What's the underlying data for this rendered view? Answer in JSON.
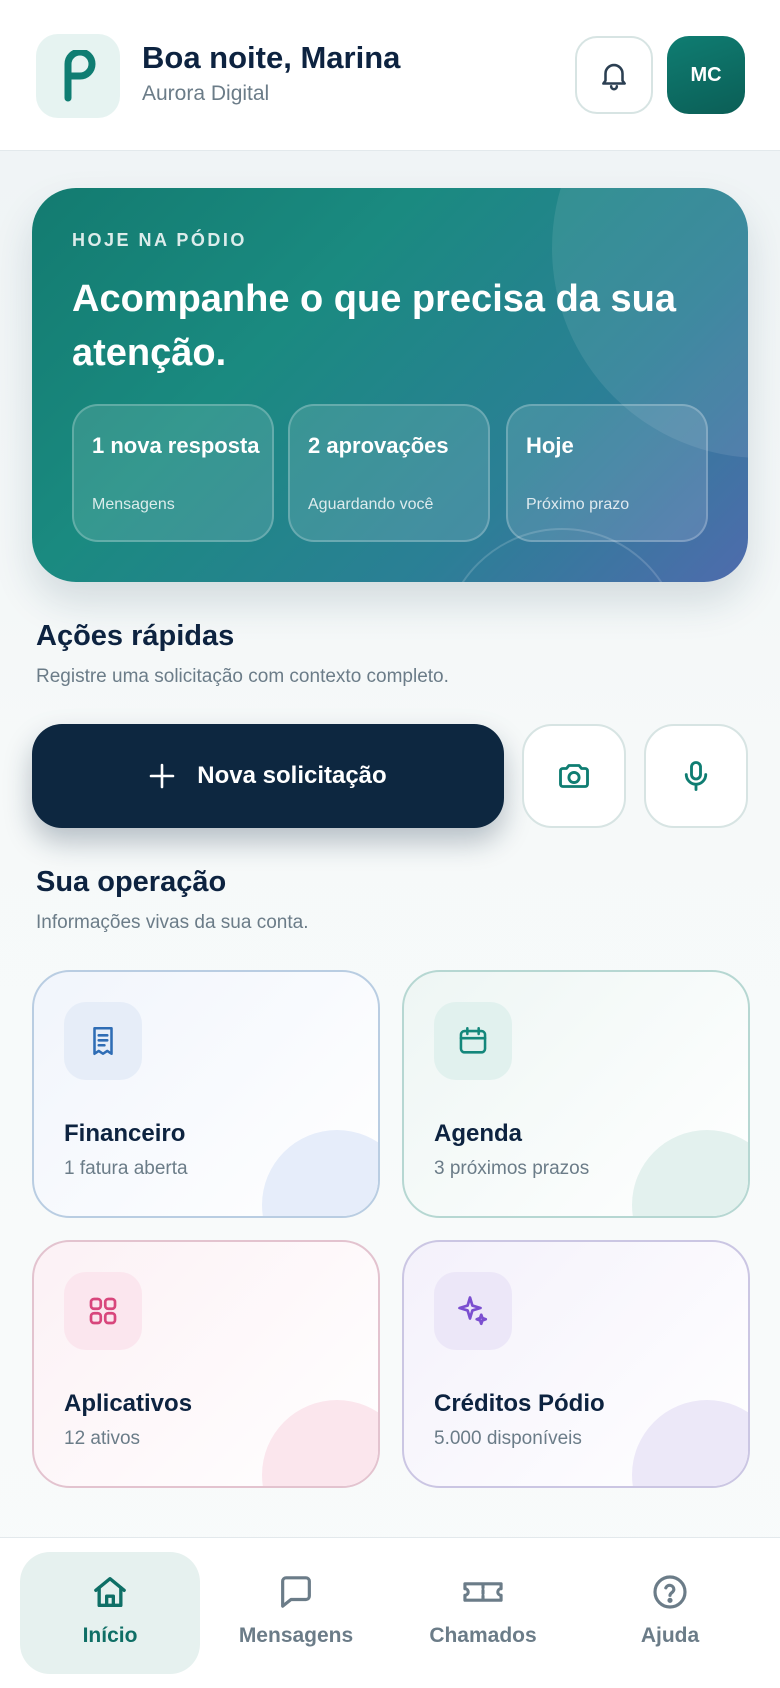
{
  "header": {
    "logo_letter": "P",
    "greeting": "Boa noite, Marina",
    "company": "Aurora Digital",
    "avatar_initials": "MC",
    "icons": [
      "bell-icon"
    ]
  },
  "hero": {
    "eyebrow": "HOJE NA PÓDIO",
    "title": "Acompanhe o que precisa da sua atenção.",
    "stats": [
      {
        "title": "1 nova resposta",
        "subtitle": "Mensagens"
      },
      {
        "title": "2 aprovações",
        "subtitle": "Aguardando você"
      },
      {
        "title": "Hoje",
        "subtitle": "Próximo prazo"
      }
    ]
  },
  "quick_actions": {
    "title": "Ações rápidas",
    "subtitle": "Registre uma solicitação com contexto completo.",
    "primary_label": "Nova solicitação",
    "icons": [
      "plus-icon",
      "camera-icon",
      "microphone-icon"
    ]
  },
  "operation": {
    "title": "Sua operação",
    "subtitle": "Informações vivas da sua conta.",
    "cards": [
      {
        "title": "Financeiro",
        "subtitle": "1 fatura aberta",
        "icon": "receipt-icon"
      },
      {
        "title": "Agenda",
        "subtitle": "3 próximos prazos",
        "icon": "calendar-icon"
      },
      {
        "title": "Aplicativos",
        "subtitle": "12 ativos",
        "icon": "grid-icon"
      },
      {
        "title": "Créditos Pódio",
        "subtitle": "5.000 disponíveis",
        "icon": "sparkle-icon"
      }
    ]
  },
  "nav": {
    "items": [
      {
        "label": "Início",
        "icon": "home-icon",
        "active": true
      },
      {
        "label": "Mensagens",
        "icon": "chat-icon",
        "active": false
      },
      {
        "label": "Chamados",
        "icon": "ticket-icon",
        "active": false
      },
      {
        "label": "Ajuda",
        "icon": "help-icon",
        "active": false
      }
    ]
  },
  "colors": {
    "primary_dark": "#0d2740",
    "accent_teal": "#0f7d72",
    "muted_text": "#6b7c88",
    "finance_blue": "#2f6db5",
    "agenda_teal": "#14877b",
    "apps_pink": "#d8467c",
    "credits_purple": "#7b4fd0"
  }
}
